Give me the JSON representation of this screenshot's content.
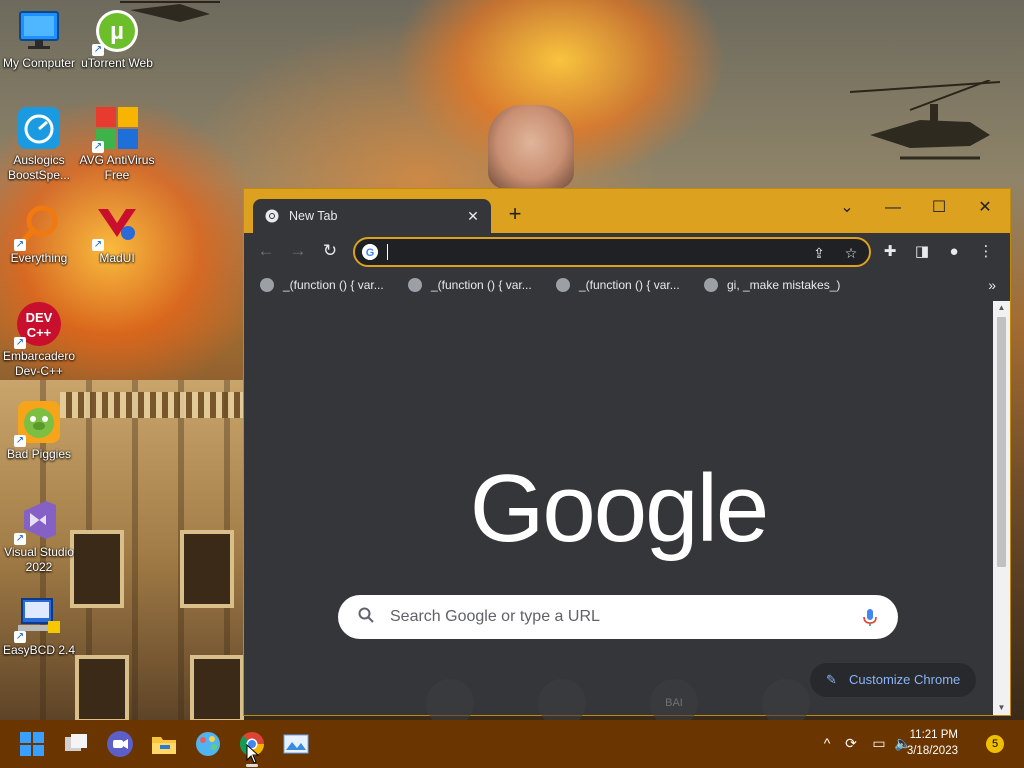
{
  "desktop": {
    "icons": [
      {
        "label": "My Computer",
        "icon": "monitor-icon"
      },
      {
        "label": "uTorrent Web",
        "icon": "utorrent-icon"
      },
      {
        "label": "Auslogics BoostSpe...",
        "icon": "auslogics-icon"
      },
      {
        "label": "AVG AntiVirus Free",
        "icon": "avg-icon"
      },
      {
        "label": "Everything",
        "icon": "everything-search-icon"
      },
      {
        "label": "MadUI",
        "icon": "madui-icon"
      },
      {
        "label": "Embarcadero Dev-C++",
        "icon": "devcpp-icon"
      },
      {
        "label": "Bad Piggies",
        "icon": "bad-piggies-icon"
      },
      {
        "label": "Visual Studio 2022",
        "icon": "visual-studio-icon"
      },
      {
        "label": "EasyBCD 2.4",
        "icon": "easybcd-icon"
      }
    ]
  },
  "chrome": {
    "tab_title": "New Tab",
    "omnibox_value": "",
    "bookmarks": [
      {
        "label": "_(function () {     var..."
      },
      {
        "label": "_(function () {     var..."
      },
      {
        "label": "_(function () {     var..."
      },
      {
        "label": "gi, _make mistakes_)"
      }
    ],
    "logo_text": "Google",
    "search_placeholder": "Search Google or type a URL",
    "shortcut_tiles": [
      "",
      "",
      "BAI",
      ""
    ],
    "customize_label": "Customize Chrome",
    "accent": "#dba11f"
  },
  "taskbar": {
    "apps": [
      "windows-start-icon",
      "task-view-icon",
      "zoom-icon",
      "file-explorer-icon",
      "paint-icon",
      "chrome-icon",
      "photos-icon"
    ],
    "clock_time": "11:21 PM",
    "clock_date": "3/18/2023",
    "notification_count": "5",
    "background": "#6b3500"
  }
}
